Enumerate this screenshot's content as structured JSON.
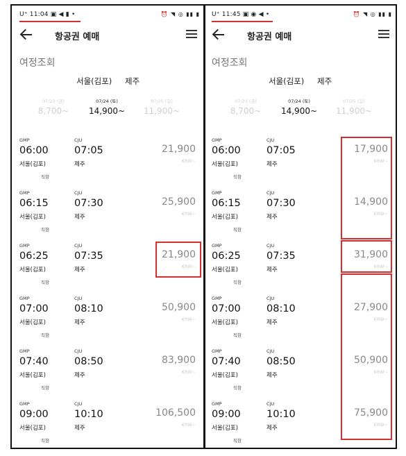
{
  "colors": {
    "highlight": "#d32f2f",
    "muted_price": "#888888"
  },
  "left": {
    "status": {
      "time": "U⁺ 11:04 ▣ ◀ ▮ •",
      "icons": "⏰ ◥ ◎ ▮▮ ▮"
    },
    "appbar": {
      "title": "항공권 예매"
    },
    "section_title": "여정조회",
    "route": {
      "from": "서울(김포)",
      "to": "제주"
    },
    "dates": [
      {
        "date": "07/23 (금)",
        "price": "8,700~"
      },
      {
        "date": "07/24 (토)",
        "price": "14,900~"
      },
      {
        "date": "07/25 (일)",
        "price": "11,900~"
      }
    ],
    "flights": [
      {
        "dep_code": "GMP",
        "dep_time": "06:00",
        "dep_city": "서울(김포)",
        "arr_code": "CJU",
        "arr_time": "07:05",
        "arr_city": "제주",
        "direct": "직항",
        "price": "21,900",
        "currency": "KRW~"
      },
      {
        "dep_code": "GMP",
        "dep_time": "06:15",
        "dep_city": "서울(김포)",
        "arr_code": "CJU",
        "arr_time": "07:30",
        "arr_city": "제주",
        "direct": "직항",
        "price": "25,900",
        "currency": "KRW~"
      },
      {
        "dep_code": "GMP",
        "dep_time": "06:25",
        "dep_city": "서울(김포)",
        "arr_code": "CJU",
        "arr_time": "07:35",
        "arr_city": "제주",
        "direct": "직항",
        "price": "21,900",
        "currency": "KRW~"
      },
      {
        "dep_code": "GMP",
        "dep_time": "07:00",
        "dep_city": "서울(김포)",
        "arr_code": "CJU",
        "arr_time": "08:10",
        "arr_city": "제주",
        "direct": "직항",
        "price": "50,900",
        "currency": "KRW~"
      },
      {
        "dep_code": "GMP",
        "dep_time": "07:40",
        "dep_city": "서울(김포)",
        "arr_code": "CJU",
        "arr_time": "08:50",
        "arr_city": "제주",
        "direct": "직항",
        "price": "83,900",
        "currency": "KRW~"
      },
      {
        "dep_code": "GMP",
        "dep_time": "09:00",
        "dep_city": "서울(김포)",
        "arr_code": "CJU",
        "arr_time": "10:10",
        "arr_city": "제주",
        "direct": "직항",
        "price": "106,500",
        "currency": "KRW~"
      }
    ]
  },
  "right": {
    "status": {
      "time": "U⁺ 11:45 ▣ ◉ ◀ •",
      "icons": "⏰ ◥ ◎ ▮▮ ▮"
    },
    "appbar": {
      "title": "항공권 예매"
    },
    "section_title": "여정조회",
    "route": {
      "from": "서울(김포)",
      "to": "제주"
    },
    "dates": [
      {
        "date": "07/23 (금)",
        "price": "8,700~"
      },
      {
        "date": "07/24 (토)",
        "price": "14,900~"
      },
      {
        "date": "07/25 (일)",
        "price": "11,900~"
      }
    ],
    "flights": [
      {
        "dep_code": "GMP",
        "dep_time": "06:00",
        "dep_city": "서울(김포)",
        "arr_code": "CJU",
        "arr_time": "07:05",
        "arr_city": "제주",
        "direct": "직항",
        "price": "17,900",
        "currency": "KRW~"
      },
      {
        "dep_code": "GMP",
        "dep_time": "06:15",
        "dep_city": "서울(김포)",
        "arr_code": "CJU",
        "arr_time": "07:30",
        "arr_city": "제주",
        "direct": "직항",
        "price": "14,900",
        "currency": "KRW~"
      },
      {
        "dep_code": "GMP",
        "dep_time": "06:25",
        "dep_city": "서울(김포)",
        "arr_code": "CJU",
        "arr_time": "07:35",
        "arr_city": "제주",
        "direct": "직항",
        "price": "31,900",
        "currency": "KRW~"
      },
      {
        "dep_code": "GMP",
        "dep_time": "07:00",
        "dep_city": "서울(김포)",
        "arr_code": "CJU",
        "arr_time": "08:10",
        "arr_city": "제주",
        "direct": "직항",
        "price": "27,900",
        "currency": "KRW~"
      },
      {
        "dep_code": "GMP",
        "dep_time": "07:40",
        "dep_city": "서울(김포)",
        "arr_code": "CJU",
        "arr_time": "08:50",
        "arr_city": "제주",
        "direct": "직항",
        "price": "50,900",
        "currency": "KRW~"
      },
      {
        "dep_code": "GMP",
        "dep_time": "09:00",
        "dep_city": "서울(김포)",
        "arr_code": "CJU",
        "arr_time": "10:10",
        "arr_city": "제주",
        "direct": "직항",
        "price": "75,900",
        "currency": "KRW~"
      }
    ]
  }
}
